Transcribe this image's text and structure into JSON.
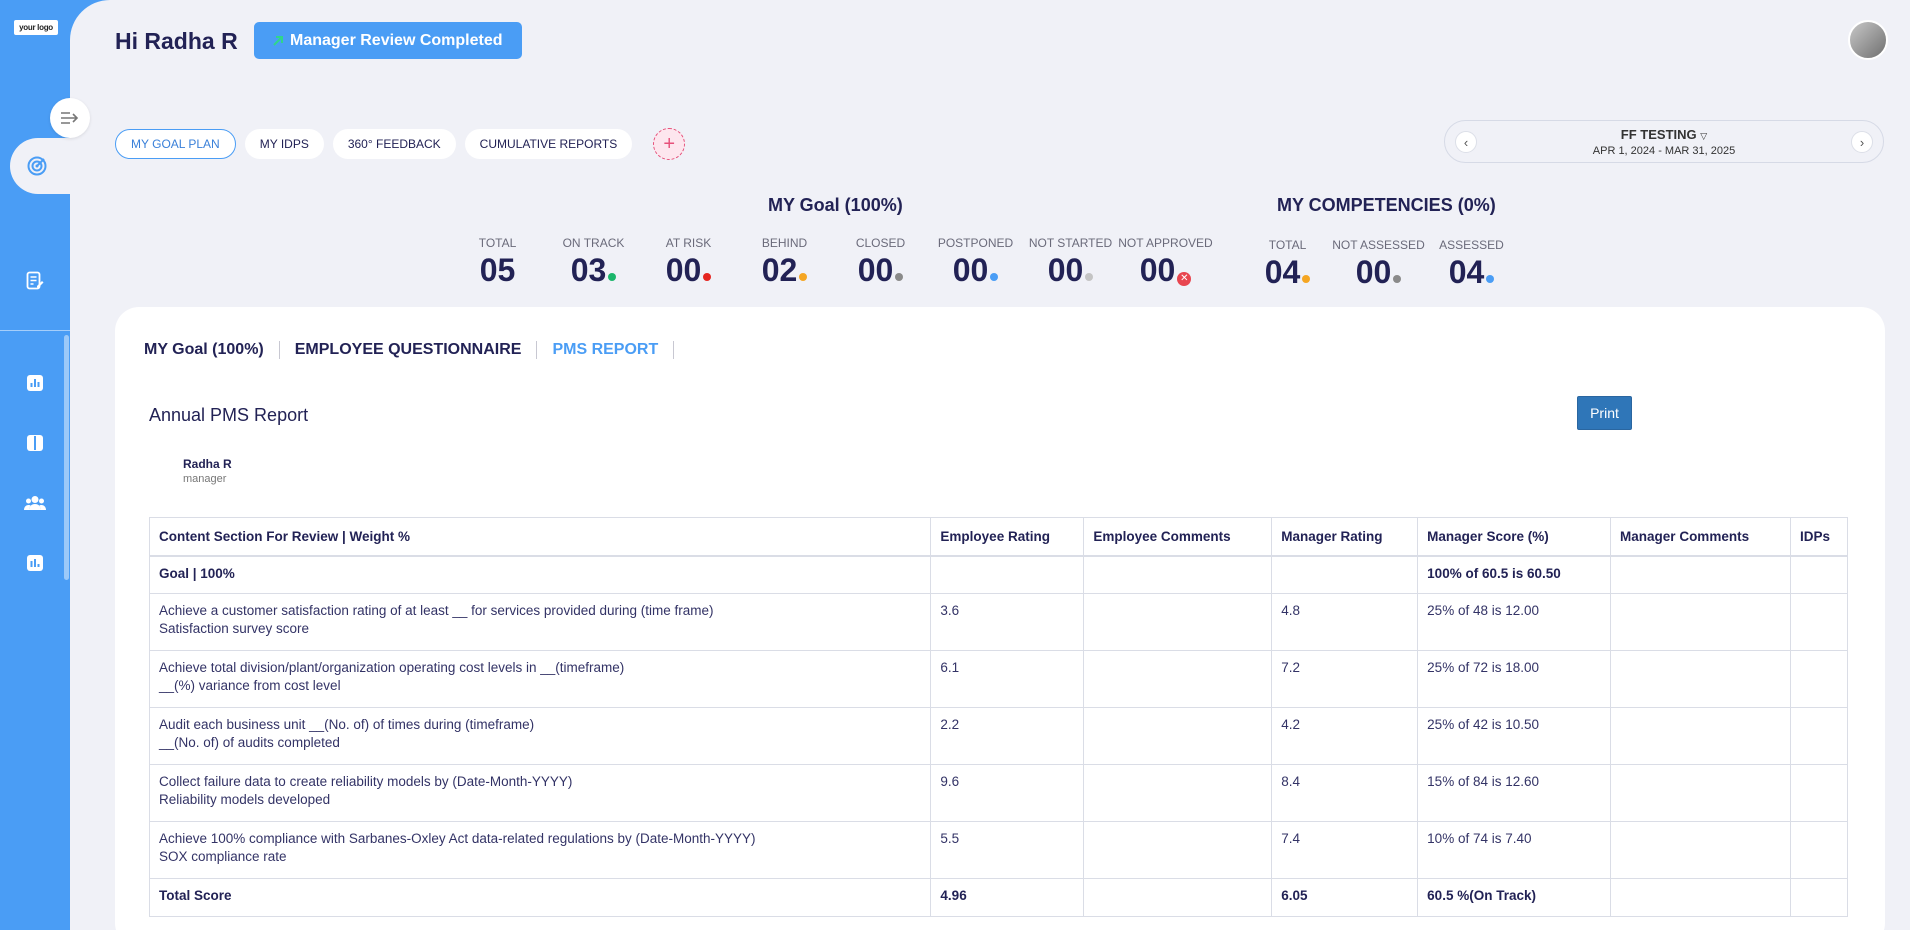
{
  "logo_text": "your logo",
  "greeting": "Hi Radha R",
  "status_button": "Manager Review Completed",
  "tabs": [
    "MY GOAL PLAN",
    "MY IDPS",
    "360° FEEDBACK",
    "CUMULATIVE REPORTS"
  ],
  "period": {
    "title": "FF TESTING",
    "range": "APR 1, 2024 - MAR 31, 2025"
  },
  "goal_section": {
    "title": "MY Goal (100%)",
    "stats": [
      {
        "label": "TOTAL",
        "value": "05",
        "color": ""
      },
      {
        "label": "ON TRACK",
        "value": "03",
        "color": "#1bb66b"
      },
      {
        "label": "AT RISK",
        "value": "00",
        "color": "#e52520"
      },
      {
        "label": "BEHIND",
        "value": "02",
        "color": "#f5a623"
      },
      {
        "label": "CLOSED",
        "value": "00",
        "color": "#8a8a8a"
      },
      {
        "label": "POSTPONED",
        "value": "00",
        "color": "#4a9df5"
      },
      {
        "label": "NOT STARTED",
        "value": "00",
        "color": "#c4c4c4"
      },
      {
        "label": "NOT APPROVED",
        "value": "00",
        "color": "#e8454f"
      }
    ]
  },
  "competency_section": {
    "title": "MY COMPETENCIES (0%)",
    "stats": [
      {
        "label": "TOTAL",
        "value": "04",
        "color": "#f5a623"
      },
      {
        "label": "NOT ASSESSED",
        "value": "00",
        "color": "#8a8a8a"
      },
      {
        "label": "ASSESSED",
        "value": "04",
        "color": "#4a9df5"
      }
    ]
  },
  "subtabs": [
    "MY Goal (100%)",
    "EMPLOYEE QUESTIONNAIRE",
    "PMS REPORT"
  ],
  "report": {
    "title": "Annual PMS Report",
    "print_label": "Print",
    "employee_name": "Radha R",
    "employee_role": "manager",
    "columns": [
      "Content Section For Review | Weight %",
      "Employee Rating",
      "Employee Comments",
      "Manager Rating",
      "Manager Score (%)",
      "Manager Comments",
      "IDPs"
    ],
    "goal_row": {
      "section": "Goal | 100%",
      "manager_score": "100% of 60.5 is 60.50"
    },
    "rows": [
      {
        "title": "Achieve a customer satisfaction rating of at least __ for services provided during (time frame)",
        "metric": "Satisfaction survey score",
        "employee_rating": "3.6",
        "manager_rating": "4.8",
        "manager_score": "25% of 48 is 12.00"
      },
      {
        "title": "Achieve total division/plant/organization operating cost levels in __(timeframe)",
        "metric": "__(%) variance from cost level",
        "employee_rating": "6.1",
        "manager_rating": "7.2",
        "manager_score": "25% of 72 is 18.00"
      },
      {
        "title": "Audit each business unit __(No. of) of times during (timeframe)",
        "metric": "__(No. of) of audits completed",
        "employee_rating": "2.2",
        "manager_rating": "4.2",
        "manager_score": "25% of 42 is 10.50"
      },
      {
        "title": "Collect failure data to create reliability models by (Date-Month-YYYY)",
        "metric": "Reliability models developed",
        "employee_rating": "9.6",
        "manager_rating": "8.4",
        "manager_score": "15% of 84 is 12.60"
      },
      {
        "title": "Achieve 100% compliance with Sarbanes-Oxley Act data-related regulations by (Date-Month-YYYY)",
        "metric": "SOX compliance rate",
        "employee_rating": "5.5",
        "manager_rating": "7.4",
        "manager_score": "10% of 74 is 7.40"
      }
    ],
    "total_row": {
      "label": "Total Score",
      "employee_rating": "4.96",
      "manager_rating": "6.05",
      "manager_score": "60.5 %(On Track)"
    }
  }
}
